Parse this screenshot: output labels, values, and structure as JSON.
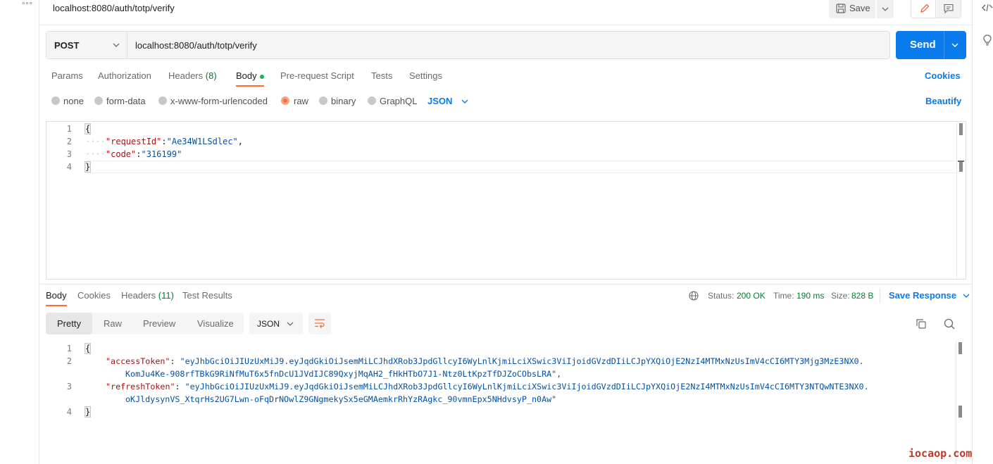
{
  "sidebar": {
    "more_glyph": "∘∘∘"
  },
  "request": {
    "title": "localhost:8080/auth/totp/verify",
    "save_label": "Save",
    "method": "POST",
    "url": "localhost:8080/auth/totp/verify",
    "send_label": "Send"
  },
  "request_tabs": [
    {
      "label": "Params"
    },
    {
      "label": "Authorization"
    },
    {
      "label": "Headers",
      "count": "(8)"
    },
    {
      "label": "Body"
    },
    {
      "label": "Pre-request Script"
    },
    {
      "label": "Tests"
    },
    {
      "label": "Settings"
    }
  ],
  "cookies_label": "Cookies",
  "body_types": [
    {
      "label": "none"
    },
    {
      "label": "form-data"
    },
    {
      "label": "x-www-form-urlencoded"
    },
    {
      "label": "raw"
    },
    {
      "label": "binary"
    },
    {
      "label": "GraphQL"
    }
  ],
  "raw_format": "JSON",
  "beautify_label": "Beautify",
  "request_body": {
    "line_numbers": [
      "1",
      "2",
      "3",
      "4"
    ],
    "open": "{",
    "close": "}",
    "k1": "\"requestId\"",
    "v1": "\"Ae34W1LSdlec\"",
    "k2": "\"code\"",
    "v2": "\"316199\"",
    "colon": ":",
    "comma": ",",
    "indent": "····"
  },
  "response_tabs": [
    {
      "label": "Body"
    },
    {
      "label": "Cookies"
    },
    {
      "label": "Headers",
      "count": "(11)"
    },
    {
      "label": "Test Results"
    }
  ],
  "status": {
    "status_label": "Status:",
    "status_value": "200 OK",
    "time_label": "Time:",
    "time_value": "190 ms",
    "size_label": "Size:",
    "size_value": "828 B",
    "save_response": "Save Response"
  },
  "view_modes": [
    {
      "label": "Pretty"
    },
    {
      "label": "Raw"
    },
    {
      "label": "Preview"
    },
    {
      "label": "Visualize"
    }
  ],
  "response_format": "JSON",
  "response_body": {
    "line_numbers": [
      "1",
      "2",
      "3",
      "4"
    ],
    "open": "{",
    "close": "}",
    "k1": "\"accessToken\"",
    "v1a": "\"eyJhbGciOiJIUzUxMiJ9.eyJqdGkiOiJsemMiLCJhdXRob3JpdGllcyI6WyLnlKjmiLciXSwic3ViIjoidGVzdDIiLCJpYXQiOjE2NzI4MTMxNzUsImV4cCI6MTY3Mjg3MzE3NX0.",
    "v1b": "KomJu4Ke-908rfTBkG9RiNfMuT6x5fnDcU1JVdIJC89QxyjMqAH2_fHkHTbO7J1-Ntz0LtKpzTfDJZoCObsLRA\",",
    "k2": "\"refreshToken\"",
    "v2a": "\"eyJhbGciOiJIUzUxMiJ9.eyJqdGkiOiJsemMiLCJhdXRob3JpdGllcyI6WyLnlKjmiLciXSwic3ViIjoidGVzdDIiLCJpYXQiOjE2NzI4MTMxNzUsImV4cCI6MTY3NTQwNTE3NX0.",
    "v2b": "oKJldysynVS_XtqrHs2UG7Lwn-oFqDrNOwlZ9GNgmekySx5eGMAemkrRhYzRAgkc_90vmnEpx5NHdvsyP_n0Aw\"",
    "colon": ": "
  },
  "watermark": "iocaop.com",
  "colors": {
    "accent": "#097bed",
    "tab_underline": "#ff6c37",
    "status_green": "#007f31"
  }
}
